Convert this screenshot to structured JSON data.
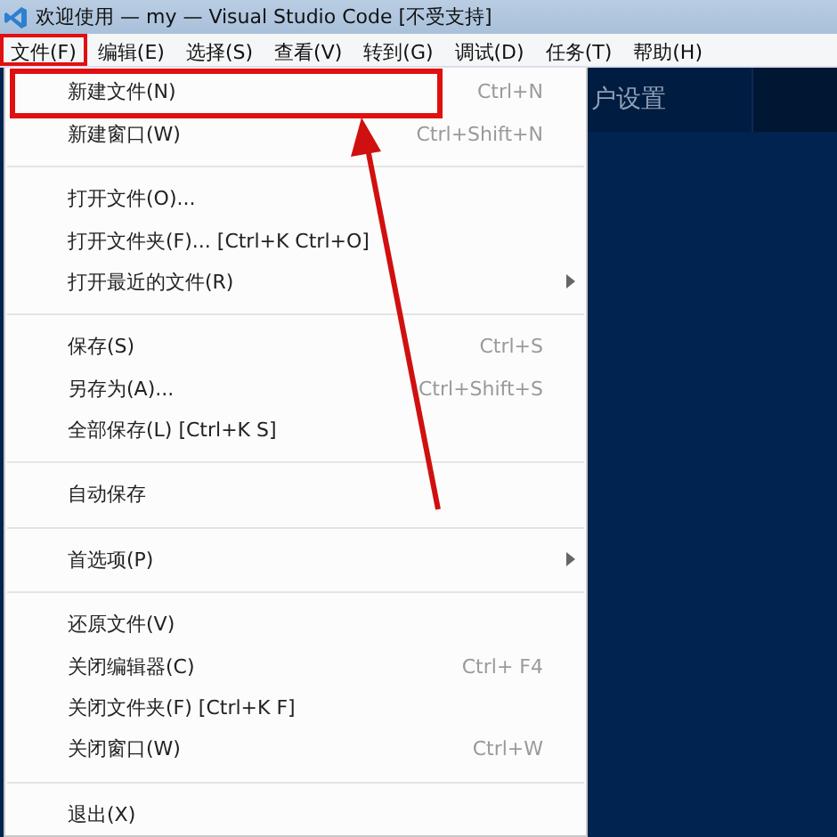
{
  "window": {
    "title": "欢迎使用 — my — Visual Studio Code [不受支持]"
  },
  "menubar": [
    {
      "label": "文件(F)",
      "selected": true
    },
    {
      "label": "编辑(E)",
      "selected": false
    },
    {
      "label": "选择(S)",
      "selected": false
    },
    {
      "label": "查看(V)",
      "selected": false
    },
    {
      "label": "转到(G)",
      "selected": false
    },
    {
      "label": "调试(D)",
      "selected": false
    },
    {
      "label": "任务(T)",
      "selected": false
    },
    {
      "label": "帮助(H)",
      "selected": false
    }
  ],
  "editor": {
    "tab": "户设置"
  },
  "menu": [
    {
      "kind": "item",
      "label": "新建文件(N)",
      "shortcut": "Ctrl+N"
    },
    {
      "kind": "item",
      "label": "新建窗口(W)",
      "shortcut": "Ctrl+Shift+N"
    },
    {
      "kind": "separator"
    },
    {
      "kind": "item",
      "label": "打开文件(O)..."
    },
    {
      "kind": "item",
      "label": "打开文件夹(F)... [Ctrl+K Ctrl+O]"
    },
    {
      "kind": "item",
      "label": "打开最近的文件(R)",
      "submenu": true
    },
    {
      "kind": "separator"
    },
    {
      "kind": "item",
      "label": "保存(S)",
      "shortcut": "Ctrl+S"
    },
    {
      "kind": "item",
      "label": "另存为(A)...",
      "shortcut": "Ctrl+Shift+S"
    },
    {
      "kind": "item",
      "label": "全部保存(L) [Ctrl+K S]"
    },
    {
      "kind": "separator"
    },
    {
      "kind": "item",
      "label": "自动保存"
    },
    {
      "kind": "separator"
    },
    {
      "kind": "item",
      "label": "首选项(P)",
      "submenu": true
    },
    {
      "kind": "separator"
    },
    {
      "kind": "item",
      "label": "还原文件(V)"
    },
    {
      "kind": "item",
      "label": "关闭编辑器(C)",
      "shortcut": "Ctrl+ F4"
    },
    {
      "kind": "item",
      "label": "关闭文件夹(F) [Ctrl+K F]"
    },
    {
      "kind": "item",
      "label": "关闭窗口(W)",
      "shortcut": "Ctrl+W"
    },
    {
      "kind": "separator"
    },
    {
      "kind": "item",
      "label": "退出(X)"
    }
  ]
}
